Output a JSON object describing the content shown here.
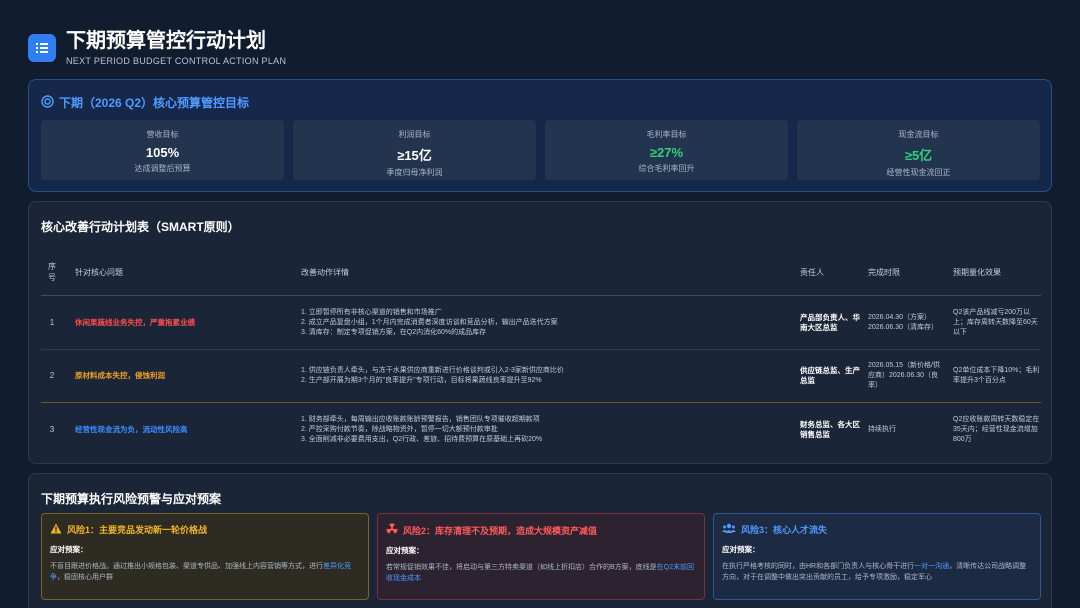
{
  "header": {
    "title": "下期预算管控行动计划",
    "subtitle": "NEXT PERIOD BUDGET CONTROL ACTION PLAN",
    "icon": "list-icon"
  },
  "goals": {
    "title": "下期（2026 Q2）核心预算管控目标",
    "icon": "target-icon",
    "cards": [
      {
        "label": "营收目标",
        "value": "105%",
        "note": "达成调整后预算",
        "color": "#ffffff"
      },
      {
        "label": "利润目标",
        "value": "≥15亿",
        "note": "季度归母净利润",
        "color": "#ffffff"
      },
      {
        "label": "毛利率目标",
        "value": "≥27%",
        "note": "综合毛利率回升",
        "color": "#2fd27a"
      },
      {
        "label": "现金流目标",
        "value": "≥5亿",
        "note": "经营性现金流回正",
        "color": "#2fd27a"
      }
    ]
  },
  "plan": {
    "title": "核心改善行动计划表（SMART原则）",
    "columns": [
      "序号",
      "针对核心问题",
      "改善动作详情",
      "责任人",
      "完成时限",
      "预期量化效果"
    ],
    "rows": [
      {
        "num": "1",
        "issue": "休闲果蔬线业务失控，严重拖累业绩",
        "issue_color": "#ff4d4d",
        "actions": [
          "1. 立即暂停所有非核心渠道的销售和市场推广",
          "2. 成立产品复盘小组，1个月内完成消费者深度访谈和竞品分析，输出产品迭代方案",
          "3. 清库存：制定专项促销方案，在Q2内消化60%的成品库存"
        ],
        "owner": "产品部负责人、华南大区总监",
        "deadline": "2026.04.30（方案）2026.06.30（清库存）",
        "effect": "Q2该产品线减亏200万以上；库存周转天数降至60天以下"
      },
      {
        "num": "2",
        "issue": "原材料成本失控，侵蚀利润",
        "issue_color": "#f0a020",
        "actions": [
          "1. 供应链负责人牵头，与冻干水果供应商重新进行价格谈判或引入2-3家新供应商比价",
          "2. 生产部开展为期3个月的\"良率提升\"专项行动，目标将果蔬线良率提升至92%"
        ],
        "owner": "供应链总监、生产总监",
        "deadline": "2026.05.15（新价格/供应商）2026.06.30（良率）",
        "effect": "Q2单位成本下降10%；毛利率提升3个百分点"
      },
      {
        "num": "3",
        "issue": "经营性现金流为负，流动性风险高",
        "issue_color": "#3d8bff",
        "actions": [
          "1. 财务部牵头，每周输出应收账款账龄预警报告，销售团队专项催收超期款项",
          "2. 严控采购付款节奏，除战略物资外，暂停一切大额预付款审批",
          "3. 全面削减非必要费用支出，Q2行政、差旅、招待费预算在原基础上再砍20%"
        ],
        "owner": "财务总监、各大区销售总监",
        "deadline": "持续执行",
        "effect": "Q2应收账款周转天数稳定在35天内；经营性现金流增加800万"
      }
    ]
  },
  "risks": {
    "title": "下期预算执行风险预警与应对预案",
    "response_label": "应对预案：",
    "cards": [
      {
        "icon": "warning-icon",
        "title": "风险1：主要竞品发动新一轮价格战",
        "color": "#f0b429",
        "bg": "#2e2c22",
        "border": "#7a6524",
        "text_before": "不盲目跟进价格战。通过推出小规格包装、渠道专供品、加强线上内容营销等方式，进行",
        "highlight": "差异化竞争",
        "text_after": "，稳固核心用户群"
      },
      {
        "icon": "hazard-icon",
        "title": "风险2：库存清理不及预期，造成大规模资产减值",
        "color": "#ff5a5a",
        "bg": "#2c2230",
        "border": "#7a3040",
        "text_before": "若常规促销效果不佳，将启动与第三方特卖渠道（如线上折扣店）合作的B方案，底线是",
        "highlight": "在Q2末前回收现金成本",
        "text_after": ""
      },
      {
        "icon": "users-icon",
        "title": "风险3：核心人才流失",
        "color": "#4f9bff",
        "bg": "#1d2a44",
        "border": "#2f5690",
        "text_before": "在执行严格考核的同时，由HR和各部门负责人与核心骨干进行",
        "highlight": "一对一沟通",
        "text_after": "，清晰传达公司战略调整方向，对于在调整中做出突出贡献的员工，给予专项激励，稳定军心"
      }
    ]
  }
}
